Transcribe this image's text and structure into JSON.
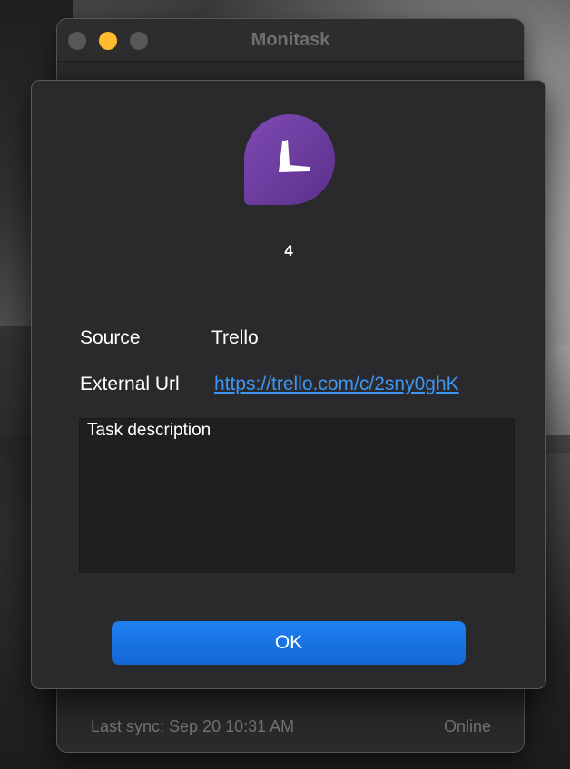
{
  "window": {
    "title": "Monitask"
  },
  "status_bar": {
    "last_sync": "Last sync: Sep 20 10:31 AM",
    "connection": "Online"
  },
  "dialog": {
    "app_icon": "monitask-clock-icon",
    "task_number": "4",
    "source_label": "Source",
    "source_value": "Trello",
    "external_url_label": "External Url",
    "external_url_value": "https://trello.com/c/2sny0ghK",
    "description": "Task description",
    "ok_label": "OK"
  },
  "colors": {
    "accent_blue": "#1f7ff0",
    "link_blue": "#3d95f4",
    "icon_purple": "#6a3d9a",
    "minimize_yellow": "#febc2e"
  }
}
